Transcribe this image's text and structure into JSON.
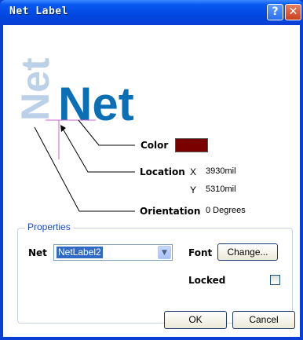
{
  "window": {
    "title": "Net Label",
    "help_glyph": "?",
    "close_glyph": "✕"
  },
  "logo": {
    "large_text": "Net",
    "rotated_text": "Net",
    "text_color": "#0a6fb5",
    "rotated_color": "#bcd0e8"
  },
  "callouts": {
    "color_label": "Color",
    "color_value": "#7a0000",
    "location_label": "Location",
    "x_label": "X",
    "x_value": "3930mil",
    "y_label": "Y",
    "y_value": "5310mil",
    "orientation_label": "Orientation",
    "orientation_value": "0 Degrees"
  },
  "properties": {
    "group_title": "Properties",
    "net_label": "Net",
    "net_value": "NetLabel2",
    "font_label": "Font",
    "change_button": "Change...",
    "locked_label": "Locked",
    "locked_checked": false
  },
  "buttons": {
    "ok": "OK",
    "cancel": "Cancel"
  }
}
